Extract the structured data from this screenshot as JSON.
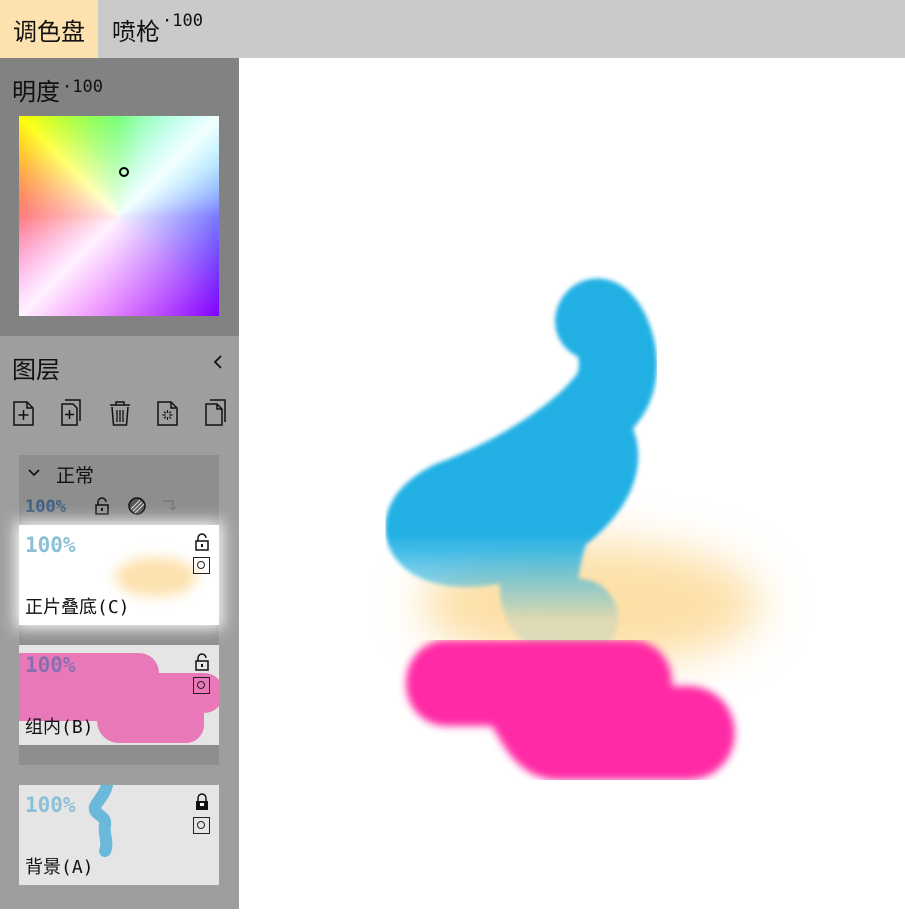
{
  "topbar": {
    "tabs": [
      {
        "label": "调色盘"
      },
      {
        "label": "喷枪",
        "value": "·100"
      }
    ]
  },
  "color_panel": {
    "brightness_label": "明度",
    "brightness_value": "·100"
  },
  "layers_panel": {
    "title": "图层",
    "collapse_icon": "chevron-left-icon",
    "tools": [
      "new-layer-icon",
      "new-group-icon",
      "trash-icon",
      "merge-icon",
      "duplicate-icon"
    ],
    "group": {
      "blend_mode": "正常",
      "opacity": "100%"
    },
    "layers": [
      {
        "opacity": "100%",
        "name": "正片叠底(C)",
        "thumbnail_color": "#fde2b0"
      },
      {
        "opacity": "100%",
        "name": "组内(B)",
        "thumbnail_color": "#e878b8"
      },
      {
        "opacity": "100%",
        "name": "背景(A)",
        "thumbnail_color": "#6ab8da"
      }
    ]
  },
  "canvas": {
    "stroke_colors": [
      "#22b0e4",
      "#fde0a8",
      "#ff2aa5"
    ]
  }
}
